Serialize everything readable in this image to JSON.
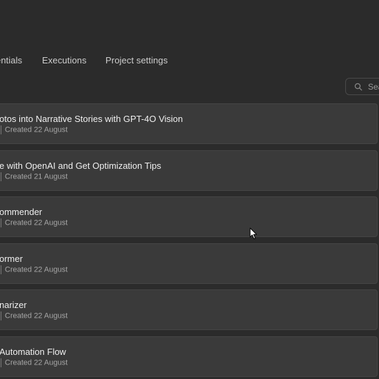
{
  "tabs": {
    "credentials": "entials",
    "executions": "Executions",
    "project_settings": "Project settings"
  },
  "search": {
    "placeholder": "Search"
  },
  "workflows": [
    {
      "title": "otos into Narrative Stories with GPT-4O Vision",
      "created": "Created 22 August"
    },
    {
      "title": "e with OpenAI and Get Optimization Tips",
      "created": "Created 21 August"
    },
    {
      "title": "ommender",
      "created": "Created 22 August"
    },
    {
      "title": "ormer",
      "created": "Created 22 August"
    },
    {
      "title": "narizer",
      "created": "Created 22 August"
    },
    {
      "title": "Automation Flow",
      "created": "Created 22 August"
    }
  ],
  "colors": {
    "background": "#2b2b2b",
    "card": "#3a3a3a",
    "card_border": "#454545",
    "text": "#efefef",
    "muted": "#a5a5a5"
  }
}
